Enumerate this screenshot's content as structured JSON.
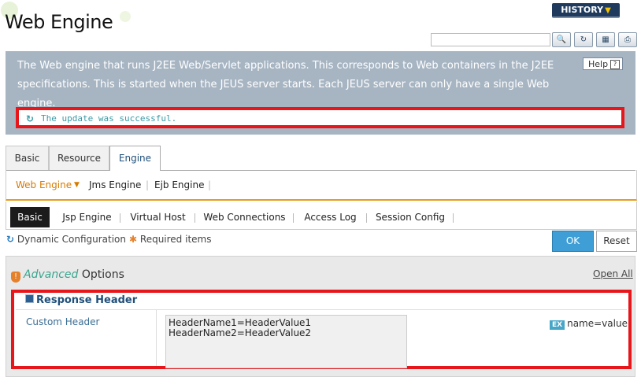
{
  "header": {
    "title": "Web Engine",
    "history_label": "HISTORY",
    "search_value": "",
    "toolbar_icons": [
      "search-icon",
      "refresh-icon",
      "xml-icon",
      "export-icon"
    ]
  },
  "description": {
    "text": "The Web engine that runs J2EE Web/Servlet applications. This corresponds to Web containers in the J2EE specifications. This is started when the JEUS server starts. Each JEUS server can only have a single Web engine.",
    "help_label": "Help",
    "success_message": "The update was successful."
  },
  "tabs_level1": [
    "Basic",
    "Resource",
    "Engine"
  ],
  "tabs_level1_active": "Engine",
  "tabs_level2": [
    "Web Engine",
    "Jms Engine",
    "Ejb Engine"
  ],
  "tabs_level2_active": "Web Engine",
  "tabs_level3": [
    "Basic",
    "Jsp Engine",
    "Virtual Host",
    "Web Connections",
    "Access Log",
    "Session Config"
  ],
  "tabs_level3_active": "Basic",
  "legend": {
    "dynamic": "Dynamic Configuration",
    "required": "Required items"
  },
  "buttons": {
    "ok": "OK",
    "reset": "Reset"
  },
  "options": {
    "title_italic": "Advanced",
    "title_rest": "Options",
    "open_all": "Open All",
    "section_title": "Response Header",
    "field_label": "Custom Header",
    "field_value_line1": "HeaderName1=HeaderValue1",
    "field_value_line2": "HeaderName2=HeaderValue2",
    "example_badge": "EX",
    "example_text": "name=value"
  },
  "colors": {
    "highlight_border": "#e6161a",
    "primary_button": "#3f9ed6",
    "active_tab_accent": "#e79b1e"
  }
}
